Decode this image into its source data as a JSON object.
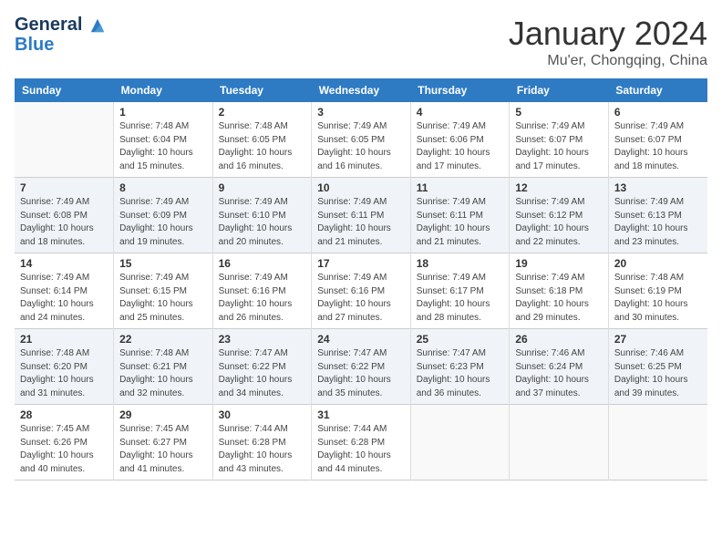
{
  "header": {
    "logo_line1": "General",
    "logo_line2": "Blue",
    "title": "January 2024",
    "location": "Mu'er, Chongqing, China"
  },
  "calendar": {
    "days_of_week": [
      "Sunday",
      "Monday",
      "Tuesday",
      "Wednesday",
      "Thursday",
      "Friday",
      "Saturday"
    ],
    "weeks": [
      [
        {
          "day": "",
          "info": ""
        },
        {
          "day": "1",
          "info": "Sunrise: 7:48 AM\nSunset: 6:04 PM\nDaylight: 10 hours\nand 15 minutes."
        },
        {
          "day": "2",
          "info": "Sunrise: 7:48 AM\nSunset: 6:05 PM\nDaylight: 10 hours\nand 16 minutes."
        },
        {
          "day": "3",
          "info": "Sunrise: 7:49 AM\nSunset: 6:05 PM\nDaylight: 10 hours\nand 16 minutes."
        },
        {
          "day": "4",
          "info": "Sunrise: 7:49 AM\nSunset: 6:06 PM\nDaylight: 10 hours\nand 17 minutes."
        },
        {
          "day": "5",
          "info": "Sunrise: 7:49 AM\nSunset: 6:07 PM\nDaylight: 10 hours\nand 17 minutes."
        },
        {
          "day": "6",
          "info": "Sunrise: 7:49 AM\nSunset: 6:07 PM\nDaylight: 10 hours\nand 18 minutes."
        }
      ],
      [
        {
          "day": "7",
          "info": "Sunrise: 7:49 AM\nSunset: 6:08 PM\nDaylight: 10 hours\nand 18 minutes."
        },
        {
          "day": "8",
          "info": "Sunrise: 7:49 AM\nSunset: 6:09 PM\nDaylight: 10 hours\nand 19 minutes."
        },
        {
          "day": "9",
          "info": "Sunrise: 7:49 AM\nSunset: 6:10 PM\nDaylight: 10 hours\nand 20 minutes."
        },
        {
          "day": "10",
          "info": "Sunrise: 7:49 AM\nSunset: 6:11 PM\nDaylight: 10 hours\nand 21 minutes."
        },
        {
          "day": "11",
          "info": "Sunrise: 7:49 AM\nSunset: 6:11 PM\nDaylight: 10 hours\nand 21 minutes."
        },
        {
          "day": "12",
          "info": "Sunrise: 7:49 AM\nSunset: 6:12 PM\nDaylight: 10 hours\nand 22 minutes."
        },
        {
          "day": "13",
          "info": "Sunrise: 7:49 AM\nSunset: 6:13 PM\nDaylight: 10 hours\nand 23 minutes."
        }
      ],
      [
        {
          "day": "14",
          "info": "Sunrise: 7:49 AM\nSunset: 6:14 PM\nDaylight: 10 hours\nand 24 minutes."
        },
        {
          "day": "15",
          "info": "Sunrise: 7:49 AM\nSunset: 6:15 PM\nDaylight: 10 hours\nand 25 minutes."
        },
        {
          "day": "16",
          "info": "Sunrise: 7:49 AM\nSunset: 6:16 PM\nDaylight: 10 hours\nand 26 minutes."
        },
        {
          "day": "17",
          "info": "Sunrise: 7:49 AM\nSunset: 6:16 PM\nDaylight: 10 hours\nand 27 minutes."
        },
        {
          "day": "18",
          "info": "Sunrise: 7:49 AM\nSunset: 6:17 PM\nDaylight: 10 hours\nand 28 minutes."
        },
        {
          "day": "19",
          "info": "Sunrise: 7:49 AM\nSunset: 6:18 PM\nDaylight: 10 hours\nand 29 minutes."
        },
        {
          "day": "20",
          "info": "Sunrise: 7:48 AM\nSunset: 6:19 PM\nDaylight: 10 hours\nand 30 minutes."
        }
      ],
      [
        {
          "day": "21",
          "info": "Sunrise: 7:48 AM\nSunset: 6:20 PM\nDaylight: 10 hours\nand 31 minutes."
        },
        {
          "day": "22",
          "info": "Sunrise: 7:48 AM\nSunset: 6:21 PM\nDaylight: 10 hours\nand 32 minutes."
        },
        {
          "day": "23",
          "info": "Sunrise: 7:47 AM\nSunset: 6:22 PM\nDaylight: 10 hours\nand 34 minutes."
        },
        {
          "day": "24",
          "info": "Sunrise: 7:47 AM\nSunset: 6:22 PM\nDaylight: 10 hours\nand 35 minutes."
        },
        {
          "day": "25",
          "info": "Sunrise: 7:47 AM\nSunset: 6:23 PM\nDaylight: 10 hours\nand 36 minutes."
        },
        {
          "day": "26",
          "info": "Sunrise: 7:46 AM\nSunset: 6:24 PM\nDaylight: 10 hours\nand 37 minutes."
        },
        {
          "day": "27",
          "info": "Sunrise: 7:46 AM\nSunset: 6:25 PM\nDaylight: 10 hours\nand 39 minutes."
        }
      ],
      [
        {
          "day": "28",
          "info": "Sunrise: 7:45 AM\nSunset: 6:26 PM\nDaylight: 10 hours\nand 40 minutes."
        },
        {
          "day": "29",
          "info": "Sunrise: 7:45 AM\nSunset: 6:27 PM\nDaylight: 10 hours\nand 41 minutes."
        },
        {
          "day": "30",
          "info": "Sunrise: 7:44 AM\nSunset: 6:28 PM\nDaylight: 10 hours\nand 43 minutes."
        },
        {
          "day": "31",
          "info": "Sunrise: 7:44 AM\nSunset: 6:28 PM\nDaylight: 10 hours\nand 44 minutes."
        },
        {
          "day": "",
          "info": ""
        },
        {
          "day": "",
          "info": ""
        },
        {
          "day": "",
          "info": ""
        }
      ]
    ]
  }
}
